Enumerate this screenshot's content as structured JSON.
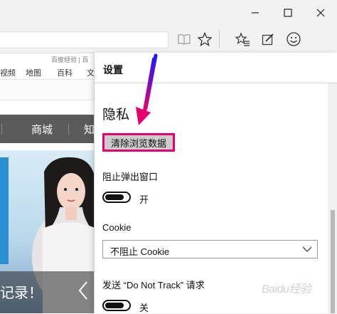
{
  "page": {
    "top_links": "百度经验 | 百",
    "nav1": [
      "视频",
      "地图",
      "百科",
      "文"
    ],
    "dark_nav": [
      "商城",
      "知"
    ],
    "hero_caption": "记录！"
  },
  "panel": {
    "title": "设置",
    "privacy_section": "隐私",
    "clear_button": "清除浏览数据",
    "block_popups_label": "阻止弹出窗口",
    "block_popups_state": "开",
    "cookie_label": "Cookie",
    "cookie_value": "不阻止 Cookie",
    "dnt_label": "发送 “Do Not Track” 请求",
    "dnt_state": "关"
  },
  "toggles": {
    "block_popups_on": true,
    "dnt_on": false
  },
  "watermark": "Baidu经验",
  "colors": {
    "highlight": "#e5006e",
    "arrow_start": "#1a1aff",
    "arrow_end": "#e5006e"
  },
  "icons": [
    "minimize-icon",
    "maximize-icon",
    "close-icon",
    "reading-view-icon",
    "favorite-star-icon",
    "hub-icon",
    "web-note-icon",
    "feedback-smiley-icon"
  ]
}
